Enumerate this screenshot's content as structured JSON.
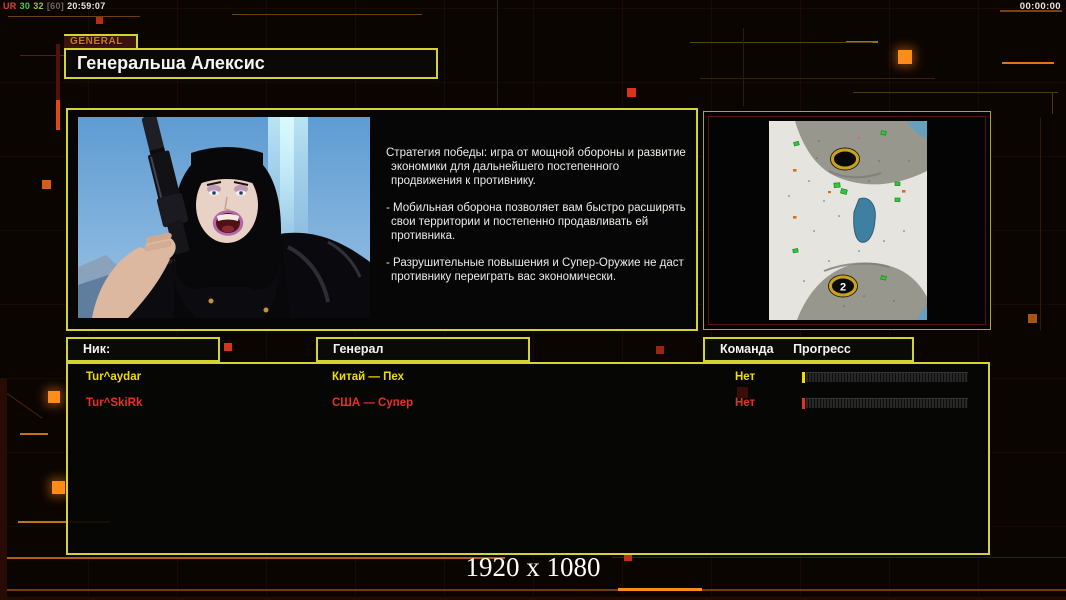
{
  "overlay": {
    "perf": {
      "tag": "UR",
      "fps": "30",
      "ping": "32",
      "cap": "[60]",
      "time": "20:59:07"
    },
    "clock": "00:00:00",
    "resolution": "1920 x 1080"
  },
  "tab": {
    "label": "GENERAL"
  },
  "header": {
    "title": "Генеральша Алексис"
  },
  "strategy": {
    "p1": "Стратегия победы: игра от мощной обороны и развитие экономики для дальнейшего постепенного продвижения к противнику.",
    "p2": "- Мобильная оборона позволяет вам быстро расширять свои территории и постепенно продавливать ей противника.",
    "p3": "- Разрушительные повышения и Супер-Оружие не даст противнику переиграть вас экономически."
  },
  "map": {
    "position_label": "2"
  },
  "table": {
    "headers": {
      "nick": "Ник:",
      "general": "Генерал",
      "team": "Команда",
      "progress": "Прогресс"
    },
    "rows": [
      {
        "nick": "Tur^aydar",
        "general": "Китай — Пех",
        "team": "Нет",
        "progress_percent": 0,
        "color": "#f0dc00"
      },
      {
        "nick": "Tur^SkiRk",
        "general": "США — Супер",
        "team": "Нет",
        "progress_percent": 0,
        "color": "#e83028"
      }
    ]
  },
  "colors": {
    "accent_yellow": "#d4d430",
    "accent_orange": "#ff8c1a",
    "perf_tag": "#d84040",
    "perf_fps": "#50c850",
    "perf_ping": "#a0c040",
    "perf_cap": "#6e665e"
  }
}
